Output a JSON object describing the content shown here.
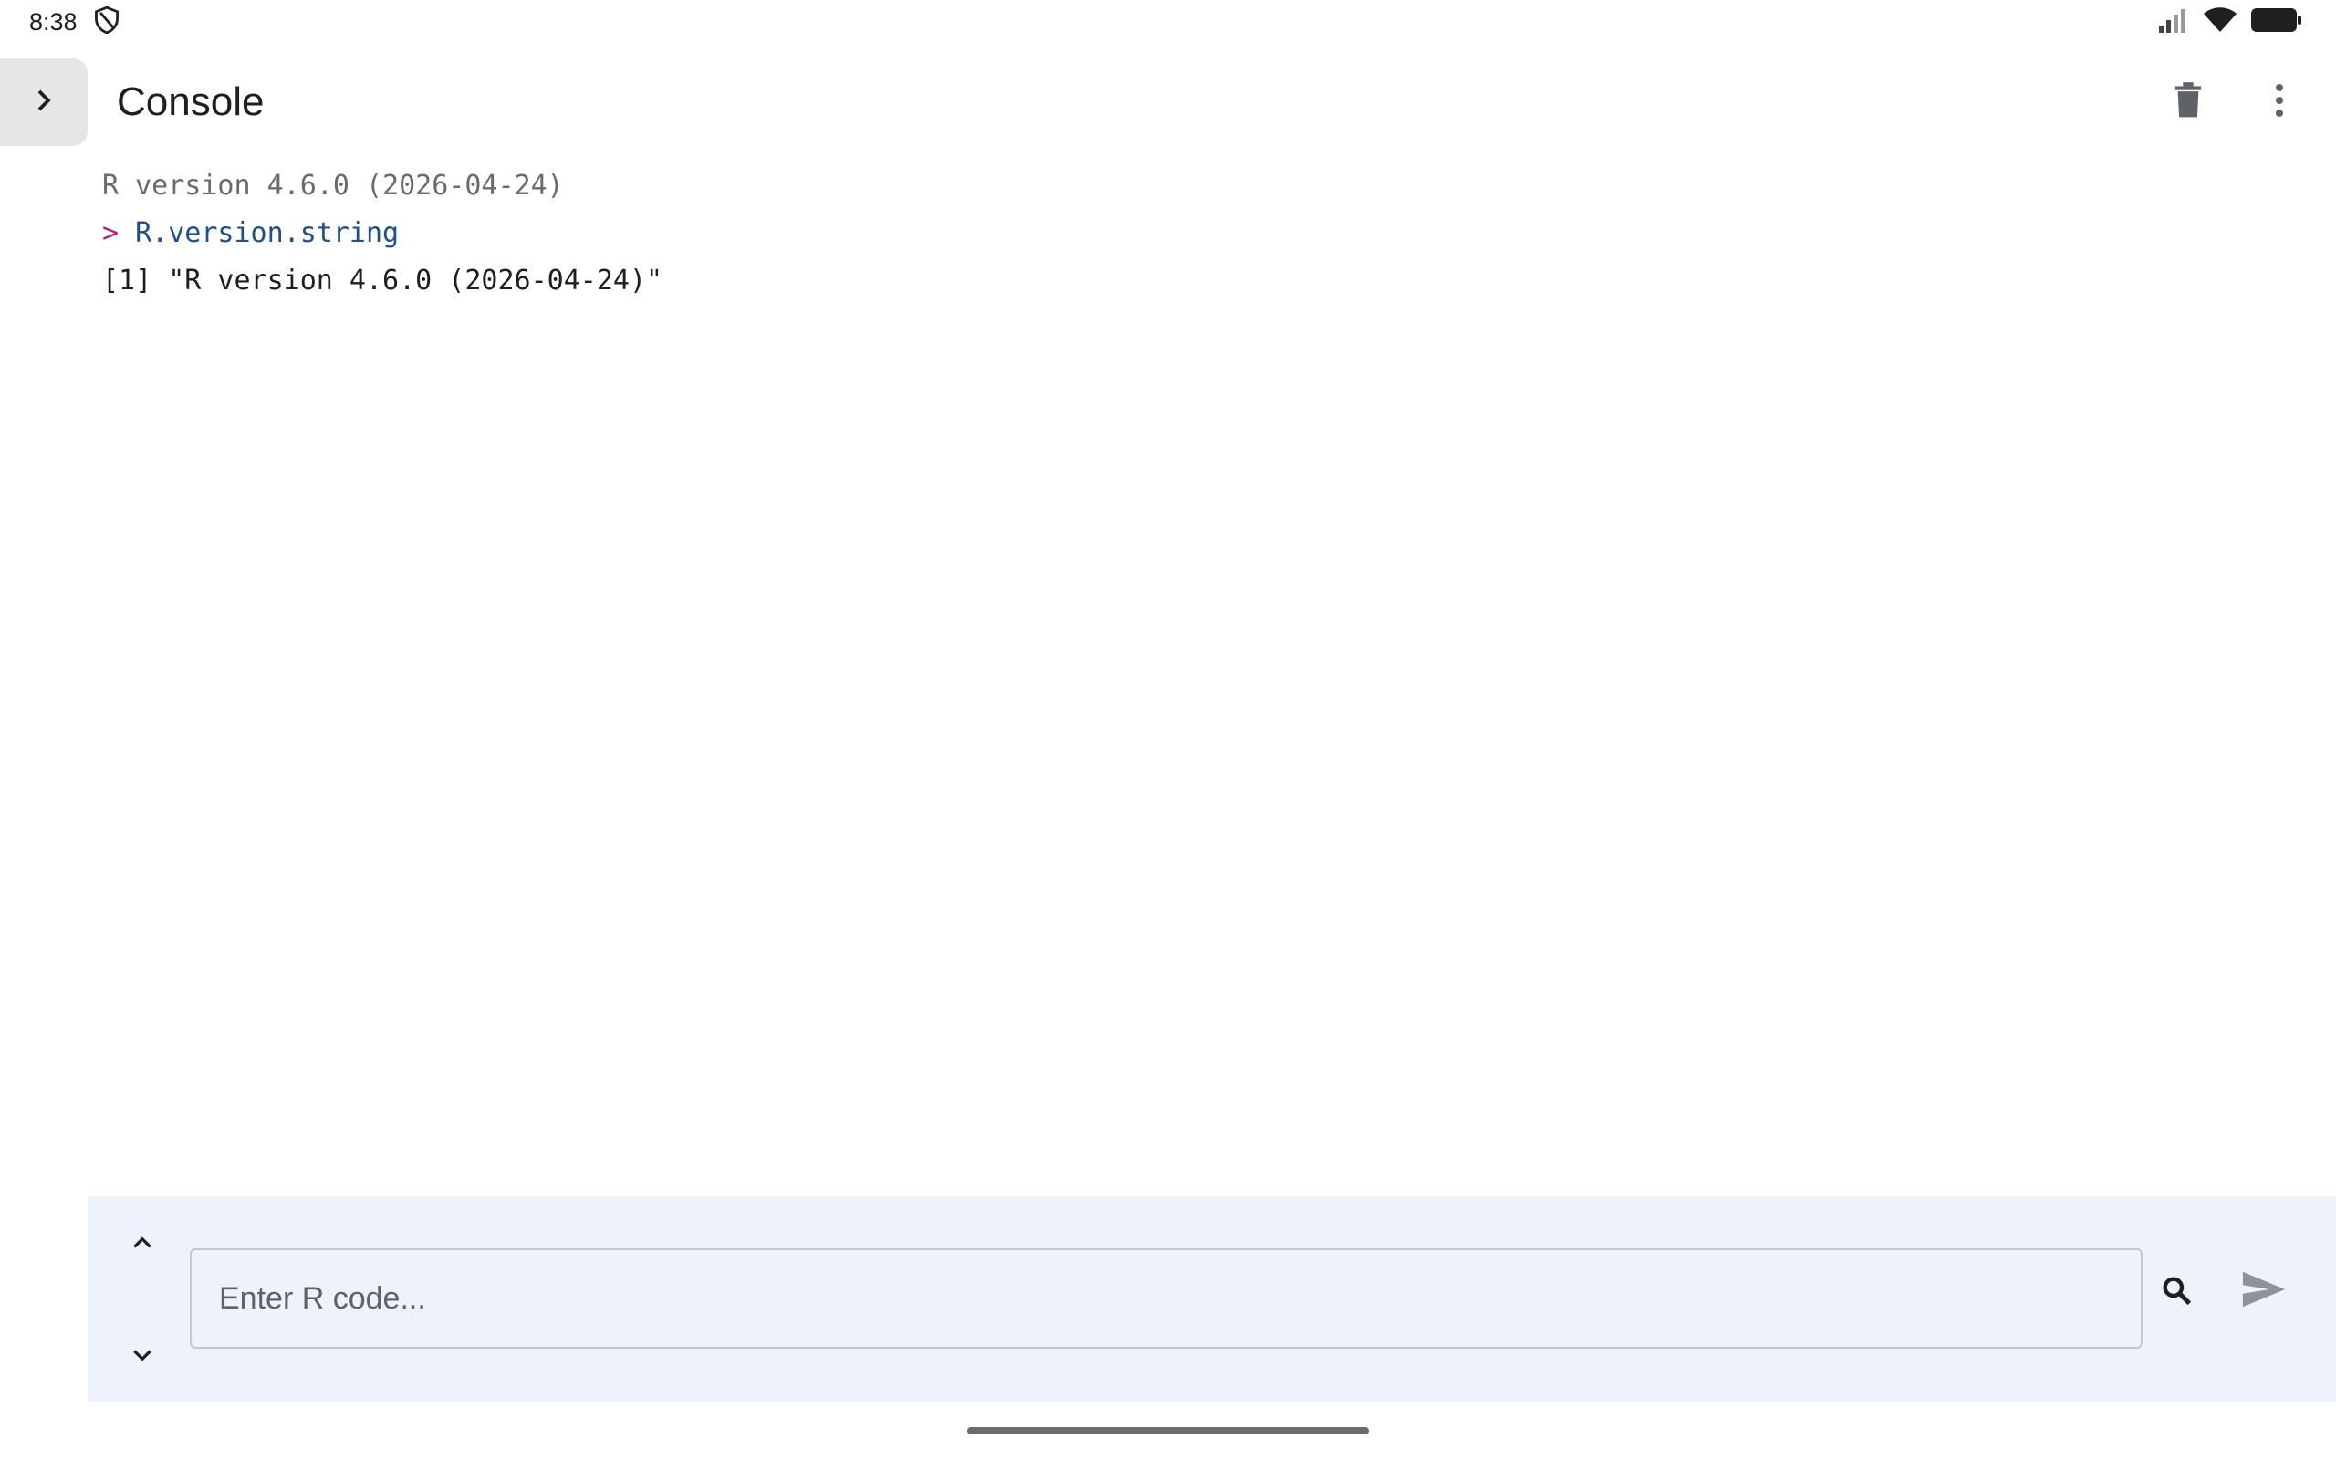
{
  "status_bar": {
    "time": "8:38",
    "icons": [
      "shield-icon",
      "signal-icon",
      "wifi-icon",
      "battery-icon"
    ]
  },
  "app_bar": {
    "title": "Console",
    "actions": [
      "clear-console-icon",
      "more-vert-icon"
    ]
  },
  "console": {
    "banner": "R version 4.6.0 (2026-04-24)",
    "prompt": ">",
    "command": "R.version.string",
    "result": "[1] \"R version 4.6.0 (2026-04-24)\""
  },
  "input": {
    "placeholder": "Enter R code...",
    "value": ""
  },
  "colors": {
    "prompt": "#b0206e",
    "command": "#1f4f8c",
    "banner": "#6b6b6b",
    "panel_bg": "#eef2fc",
    "drawer_bg": "#e6e6e8"
  }
}
